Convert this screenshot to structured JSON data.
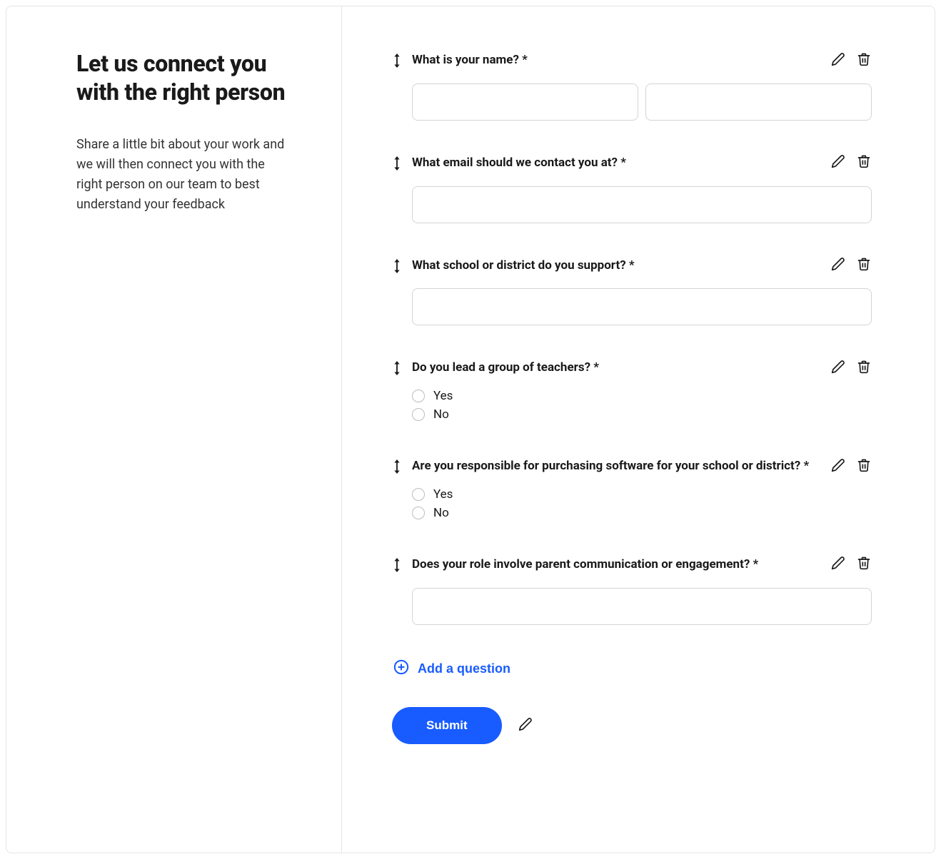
{
  "intro": {
    "title": "Let us connect you with the right person",
    "description": "Share a little bit about your work and we will then connect you with the right person on our team to best understand your feedback"
  },
  "questions": [
    {
      "label": "What is your name? *",
      "type": "name_split"
    },
    {
      "label": "What email should we contact you at? *",
      "type": "text"
    },
    {
      "label": "What school or district do you support? *",
      "type": "text"
    },
    {
      "label": "Do you lead a group of teachers? *",
      "type": "radio",
      "options": [
        "Yes",
        "No"
      ]
    },
    {
      "label": "Are you responsible for purchasing software for your school or district? *",
      "type": "radio",
      "options": [
        "Yes",
        "No"
      ]
    },
    {
      "label": "Does your role involve parent communication or engagement? *",
      "type": "text"
    }
  ],
  "actions": {
    "add_question": "Add a question",
    "submit": "Submit"
  },
  "icons": {
    "drag": "drag-vertical-icon",
    "edit": "pencil-icon",
    "delete": "trash-icon",
    "plus_circle": "plus-circle-icon"
  }
}
